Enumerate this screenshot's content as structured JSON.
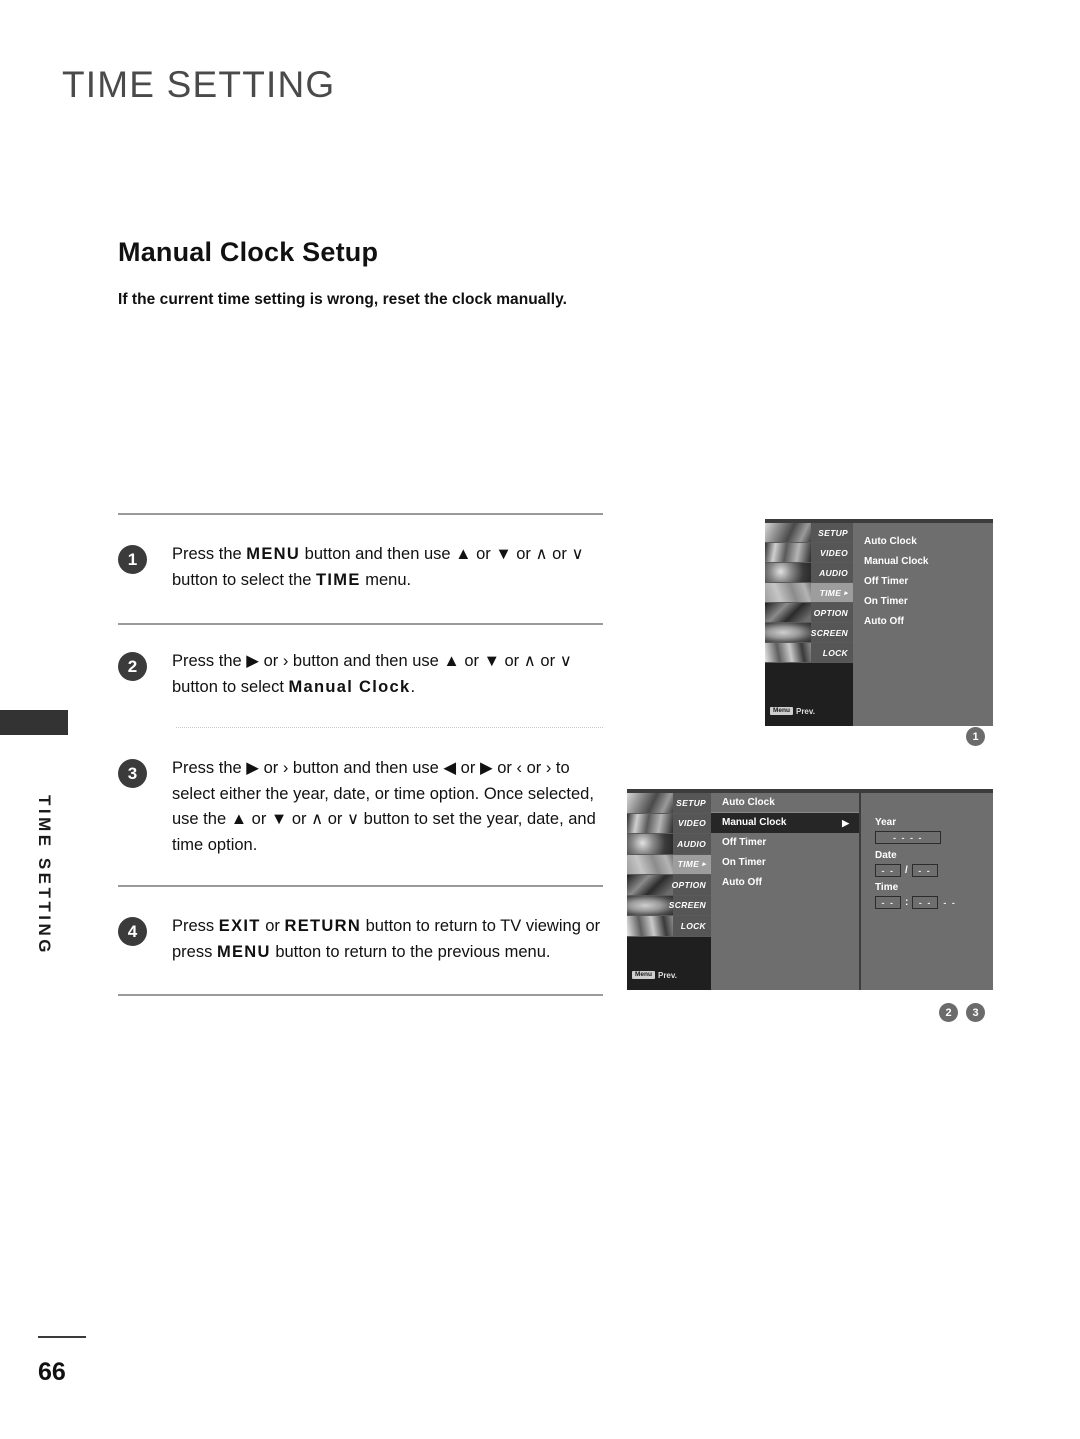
{
  "page": {
    "title": "TIME SETTING",
    "side_label": "TIME SETTING",
    "number": "66"
  },
  "section": {
    "heading": "Manual Clock Setup",
    "subtitle": "If the current time setting is wrong, reset the clock manually."
  },
  "steps": [
    {
      "num": "1",
      "parts": [
        {
          "t": "Press the ",
          "b": false
        },
        {
          "t": "MENU",
          "b": true
        },
        {
          "t": " button and then use ",
          "b": false
        },
        {
          "t": "▲",
          "b": false
        },
        {
          "t": " or ",
          "b": false
        },
        {
          "t": "▼",
          "b": false
        },
        {
          "t": "  or  ",
          "b": false
        },
        {
          "t": "∧",
          "b": false
        },
        {
          "t": "  or  ",
          "b": false
        },
        {
          "t": "∨",
          "b": false
        },
        {
          "t": "  button to select the ",
          "b": false
        },
        {
          "t": "TIME",
          "b": true
        },
        {
          "t": " menu.",
          "b": false
        }
      ]
    },
    {
      "num": "2",
      "parts": [
        {
          "t": "Press the ",
          "b": false
        },
        {
          "t": "▶",
          "b": false
        },
        {
          "t": "  or  ",
          "b": false
        },
        {
          "t": "›",
          "b": false
        },
        {
          "t": "  button and then use ",
          "b": false
        },
        {
          "t": "▲",
          "b": false
        },
        {
          "t": " or ",
          "b": false
        },
        {
          "t": "▼",
          "b": false
        },
        {
          "t": "  or  ",
          "b": false
        },
        {
          "t": "∧",
          "b": false
        },
        {
          "t": "  or  ",
          "b": false
        },
        {
          "t": "∨",
          "b": false
        },
        {
          "t": "  button to select ",
          "b": false
        },
        {
          "t": "Manual Clock",
          "b": true
        },
        {
          "t": ".",
          "b": false
        }
      ]
    },
    {
      "num": "3",
      "parts": [
        {
          "t": "Press the ",
          "b": false
        },
        {
          "t": "▶",
          "b": false
        },
        {
          "t": "  or  ",
          "b": false
        },
        {
          "t": "›",
          "b": false
        },
        {
          "t": "  button and then use ",
          "b": false
        },
        {
          "t": "◀",
          "b": false
        },
        {
          "t": " or ",
          "b": false
        },
        {
          "t": "▶",
          "b": false
        },
        {
          "t": " or ",
          "b": false
        },
        {
          "t": "‹",
          "b": false
        },
        {
          "t": "  or  ",
          "b": false
        },
        {
          "t": "›",
          "b": false
        },
        {
          "t": "  to select either the year, date, or time option. Once selected, use the ",
          "b": false
        },
        {
          "t": "▲",
          "b": false
        },
        {
          "t": " or ",
          "b": false
        },
        {
          "t": "▼",
          "b": false
        },
        {
          "t": "  or  ",
          "b": false
        },
        {
          "t": "∧",
          "b": false
        },
        {
          "t": " or ",
          "b": false
        },
        {
          "t": "∨",
          "b": false
        },
        {
          "t": "  button to set the year, date, and time option.",
          "b": false
        }
      ]
    },
    {
      "num": "4",
      "parts": [
        {
          "t": "Press ",
          "b": false
        },
        {
          "t": "EXIT",
          "b": true
        },
        {
          "t": "  or  ",
          "b": false
        },
        {
          "t": "RETURN",
          "b": true
        },
        {
          "t": " button to return to TV viewing or press ",
          "b": false
        },
        {
          "t": "MENU",
          "b": true
        },
        {
          "t": " button to return to the previous menu.",
          "b": false
        }
      ]
    }
  ],
  "osd": {
    "sidebar_items": [
      {
        "label": "SETUP",
        "active": false,
        "arrow": ""
      },
      {
        "label": "VIDEO",
        "active": false,
        "arrow": ""
      },
      {
        "label": "AUDIO",
        "active": false,
        "arrow": ""
      },
      {
        "label": "TIME",
        "active": true,
        "arrow": "▸"
      },
      {
        "label": "OPTION",
        "active": false,
        "arrow": ""
      },
      {
        "label": "SCREEN",
        "active": false,
        "arrow": ""
      },
      {
        "label": "LOCK",
        "active": false,
        "arrow": ""
      }
    ],
    "prev_badge": "Menu",
    "prev_text": "Prev.",
    "menu_items": [
      "Auto Clock",
      "Manual Clock",
      "Off Timer",
      "On Timer",
      "Auto Off"
    ],
    "selected_item": "Manual Clock",
    "selected_arrow": "▶",
    "fields": {
      "year_label": "Year",
      "year_value": "- - - -",
      "date_label": "Date",
      "date_month": "- -",
      "date_separator": "/",
      "date_day": "- -",
      "time_label": "Time",
      "time_hour": "- -",
      "time_separator": ":",
      "time_minute": "- -",
      "time_meridiem": "- -"
    }
  },
  "markers": {
    "one": "1",
    "two": "2",
    "three": "3"
  }
}
